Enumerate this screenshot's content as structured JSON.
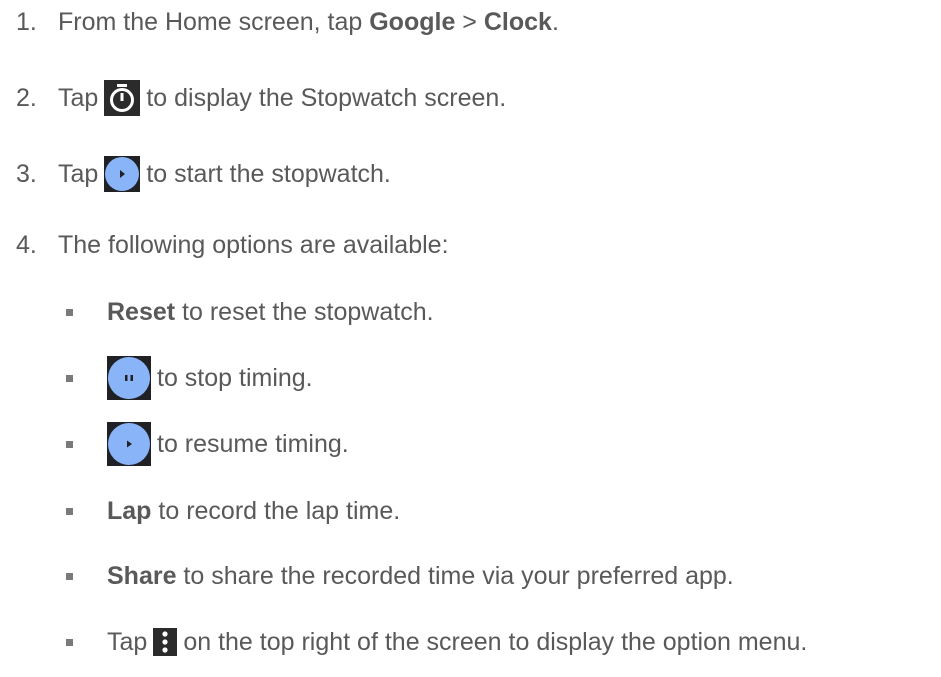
{
  "steps": [
    {
      "num": "1.",
      "pre": "From the Home screen, tap ",
      "b1": "Google",
      "mid": " > ",
      "b2": "Clock",
      "post": "."
    },
    {
      "num": "2.",
      "pre": "Tap",
      "post": "to display the Stopwatch screen.",
      "icon": "stopwatch-icon"
    },
    {
      "num": "3.",
      "pre": "Tap",
      "post": "to start the stopwatch.",
      "icon": "play-icon"
    },
    {
      "num": "4.",
      "text": "The following options are available:"
    }
  ],
  "options": [
    {
      "bold": "Reset",
      "text": " to reset the stopwatch."
    },
    {
      "text": "to stop timing.",
      "icon": "pause-icon"
    },
    {
      "text": "to resume timing.",
      "icon": "play-icon"
    },
    {
      "bold": "Lap",
      "text": " to record the lap time."
    },
    {
      "bold": "Share",
      "text": " to share the recorded time via your preferred app."
    },
    {
      "pre": "Tap",
      "text": "on the top right of the screen to display the option menu.",
      "icon": "more-vert-icon"
    }
  ],
  "colors": {
    "text": "#595959",
    "button_blue": "#8ab4f8",
    "icon_dark": "#1f1f1f"
  }
}
